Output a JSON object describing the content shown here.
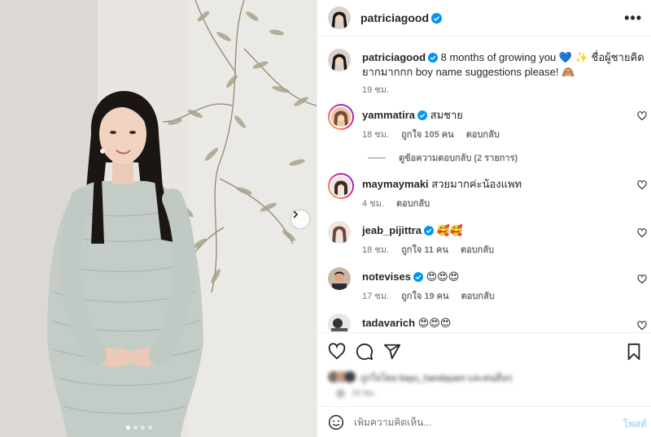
{
  "post": {
    "username": "patriciagood",
    "more_label": "•••",
    "caption": {
      "username": "patriciagood",
      "text_a": "8 months of growing you",
      "emoji_a": "💙 ✨",
      "text_b": "ชื่อผู้ชายคิดยากมากกก boy name suggestions please!",
      "emoji_b": "🙈",
      "time": "19 ชม."
    }
  },
  "comments": [
    {
      "username": "yammatira",
      "verified": true,
      "text": "สมชาย",
      "time": "18 ชม.",
      "likes": "ถูกใจ 105 คน",
      "reply": "ตอบกลับ",
      "ring": true,
      "view_replies": "ดูข้อความตอบกลับ (2 รายการ)"
    },
    {
      "username": "maymaymaki",
      "verified": false,
      "text": "สวยมากค่ะน้องแพท",
      "time": "4 ชม.",
      "likes": "",
      "reply": "ตอบกลับ",
      "ring": true
    },
    {
      "username": "jeab_pijittra",
      "verified": true,
      "text": "🥰🥰",
      "time": "18 ชม.",
      "likes": "ถูกใจ 11 คน",
      "reply": "ตอบกลับ",
      "ring": false
    },
    {
      "username": "notevises",
      "verified": true,
      "text": "😍😍😍",
      "time": "17 ชม.",
      "likes": "ถูกใจ 19 คน",
      "reply": "ตอบกลับ",
      "ring": false
    },
    {
      "username": "tadavarich",
      "verified": false,
      "text": "😍😍😍",
      "time": "",
      "likes": "",
      "reply": "",
      "ring": false
    }
  ],
  "likes_blurred": {
    "line1": "ถูกใจโดย bayu_handayani และคนอื่นๆ",
    "line2": "19 ชม."
  },
  "composer": {
    "placeholder": "เพิ่มความคิดเห็น...",
    "post_label": "โพสต์"
  },
  "icons": {
    "like": "heart-icon",
    "comment": "comment-icon",
    "share": "share-icon",
    "save": "bookmark-icon",
    "emoji": "emoji-icon",
    "verified": "verified-badge-icon",
    "next": "chevron-right-icon"
  },
  "colors": {
    "verified": "#0095f6",
    "post_button": "#b3dbff",
    "muted": "#737373"
  }
}
